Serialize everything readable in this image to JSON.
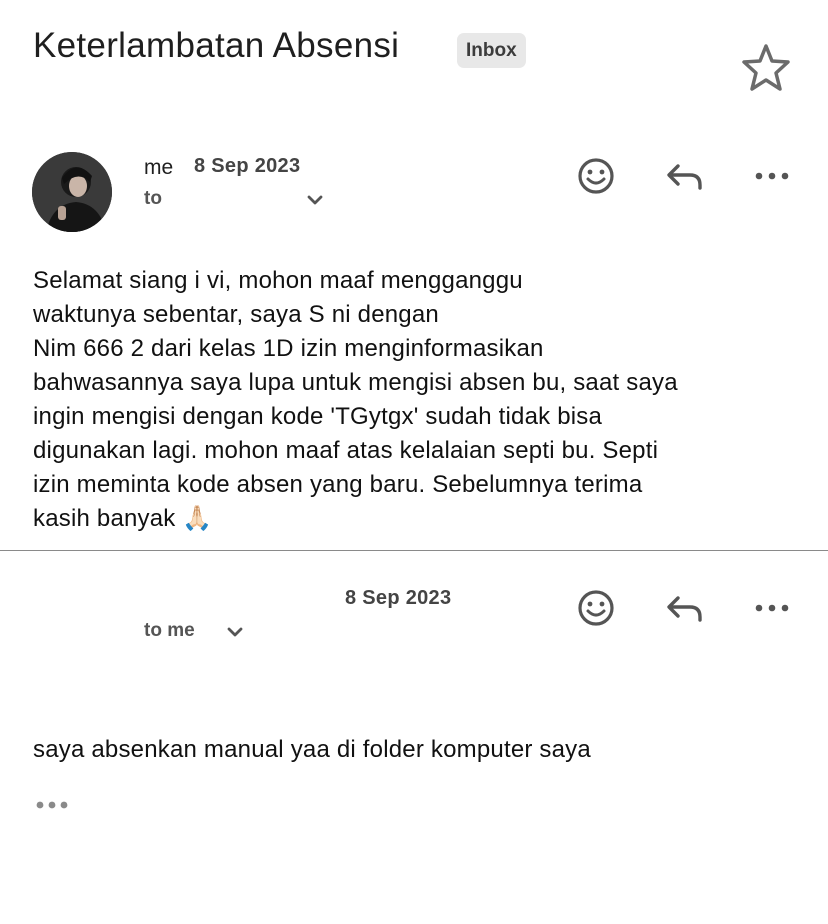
{
  "subject": "Keterlambatan Absensi",
  "label_badge": "Inbox",
  "messages": [
    {
      "sender": "me",
      "date": "8 Sep 2023",
      "recipient_prefix": "to",
      "body_lines": [
        "Selamat siang i          vi, mohon maaf mengganggu",
        "waktunya sebentar, saya S                                    ni dengan",
        "Nim 666            2 dari kelas 1D izin menginformasikan",
        "bahwasannya saya lupa untuk mengisi absen bu, saat saya",
        "ingin mengisi dengan kode 'TGytgx' sudah tidak bisa",
        "digunakan lagi. mohon maaf atas kelalaian septi bu. Septi",
        "izin meminta kode absen yang baru. Sebelumnya terima",
        "kasih banyak              🙏🏻"
      ]
    },
    {
      "sender": "",
      "date": "8 Sep 2023",
      "recipient_prefix": "to me",
      "body": "saya absenkan manual yaa di folder komputer saya"
    }
  ],
  "icons": {
    "star": "star-outline-icon",
    "react": "smiley-icon",
    "reply": "reply-icon",
    "more": "more-horizontal-icon",
    "expand": "chevron-down-icon",
    "quoted": "ellipsis-icon"
  },
  "colors": {
    "text": "#1f1f1f",
    "badge_bg": "#e8e8e8",
    "icon": "#555555",
    "divider": "#8a8a8a"
  }
}
